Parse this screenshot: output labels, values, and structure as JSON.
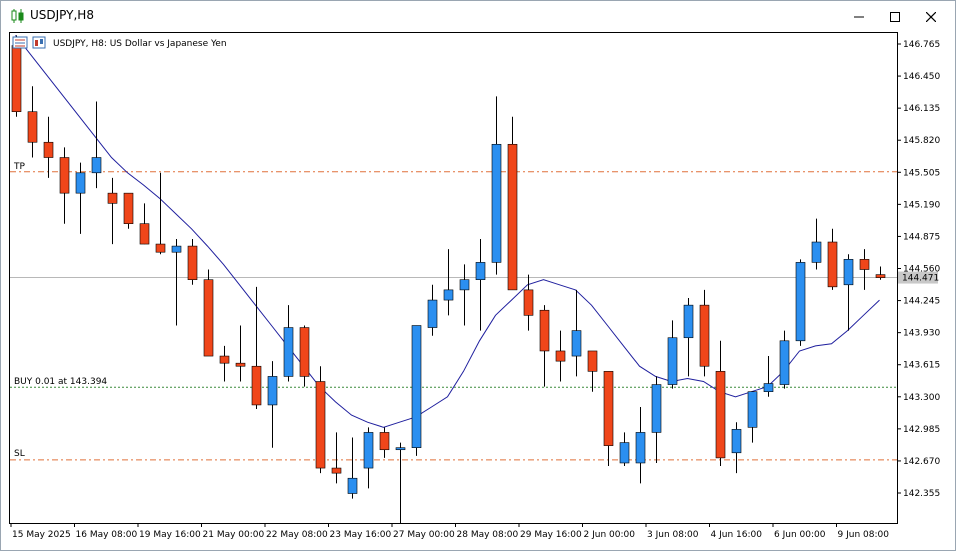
{
  "window": {
    "title": "USDJPY,H8",
    "icon": "candlestick-icon",
    "buttons": [
      "minimize-icon",
      "maximize-icon",
      "close-icon"
    ]
  },
  "chart_header": {
    "symbol_text": "USDJPY, H8:  US Dollar vs Japanese Yen"
  },
  "price_axis": {
    "labels": [
      "146.765",
      "146.450",
      "146.135",
      "145.820",
      "145.505",
      "145.190",
      "144.875",
      "144.560",
      "144.245",
      "143.930",
      "143.615",
      "143.300",
      "142.985",
      "142.670",
      "142.355"
    ],
    "current_price": "144.471"
  },
  "time_axis": {
    "labels": [
      "15 May 2025",
      "16 May 08:00",
      "19 May 16:00",
      "21 May 00:00",
      "22 May 08:00",
      "23 May 16:00",
      "27 May 00:00",
      "28 May 08:00",
      "29 May 16:00",
      "2 Jun 00:00",
      "3 Jun 08:00",
      "4 Jun 16:00",
      "6 Jun 00:00",
      "9 Jun 08:00"
    ]
  },
  "trade_lines": {
    "tp_label": "TP",
    "tp_price": 145.51,
    "buy_label": "BUY 0.01 at 143.394",
    "buy_price": 143.394,
    "sl_label": "SL",
    "sl_price": 142.68
  },
  "colors": {
    "bull": "#2b8ff0",
    "bear": "#f0461a",
    "ma": "#1f1f9e",
    "tp_sl_line": "#e0703a",
    "buy_line": "#3a8a3a",
    "grid_price": "#b8b8b8"
  },
  "chart_data": {
    "type": "candlestick",
    "title": "USDJPY, H8:  US Dollar vs Japanese Yen",
    "ylim": [
      142.2,
      146.85
    ],
    "candles": [
      {
        "o": 146.75,
        "h": 146.85,
        "l": 146.05,
        "c": 146.1
      },
      {
        "o": 146.1,
        "h": 146.35,
        "l": 145.65,
        "c": 145.8
      },
      {
        "o": 145.8,
        "h": 146.05,
        "l": 145.45,
        "c": 145.65
      },
      {
        "o": 145.65,
        "h": 145.75,
        "l": 145.0,
        "c": 145.3
      },
      {
        "o": 145.3,
        "h": 145.6,
        "l": 144.9,
        "c": 145.5
      },
      {
        "o": 145.5,
        "h": 146.2,
        "l": 145.35,
        "c": 145.65
      },
      {
        "o": 145.3,
        "h": 145.45,
        "l": 144.8,
        "c": 145.2
      },
      {
        "o": 145.3,
        "h": 145.3,
        "l": 144.95,
        "c": 145.0
      },
      {
        "o": 145.0,
        "h": 145.2,
        "l": 144.8,
        "c": 144.8
      },
      {
        "o": 144.8,
        "h": 145.5,
        "l": 144.7,
        "c": 144.72
      },
      {
        "o": 144.72,
        "h": 144.85,
        "l": 144.0,
        "c": 144.78
      },
      {
        "o": 144.78,
        "h": 144.85,
        "l": 144.4,
        "c": 144.45
      },
      {
        "o": 144.45,
        "h": 144.55,
        "l": 143.7,
        "c": 143.7
      },
      {
        "o": 143.7,
        "h": 143.8,
        "l": 143.45,
        "c": 143.63
      },
      {
        "o": 143.63,
        "h": 144.0,
        "l": 143.45,
        "c": 143.6
      },
      {
        "o": 143.6,
        "h": 144.38,
        "l": 143.18,
        "c": 143.22
      },
      {
        "o": 143.22,
        "h": 143.65,
        "l": 142.8,
        "c": 143.5
      },
      {
        "o": 143.5,
        "h": 144.2,
        "l": 143.45,
        "c": 143.98
      },
      {
        "o": 143.98,
        "h": 144.0,
        "l": 143.4,
        "c": 143.5
      },
      {
        "o": 143.45,
        "h": 143.6,
        "l": 142.55,
        "c": 142.6
      },
      {
        "o": 142.6,
        "h": 142.95,
        "l": 142.45,
        "c": 142.55
      },
      {
        "o": 142.35,
        "h": 142.9,
        "l": 142.3,
        "c": 142.5
      },
      {
        "o": 142.6,
        "h": 143.0,
        "l": 142.4,
        "c": 142.95
      },
      {
        "o": 142.95,
        "h": 143.0,
        "l": 142.7,
        "c": 142.78
      },
      {
        "o": 142.78,
        "h": 142.85,
        "l": 142.05,
        "c": 142.8
      },
      {
        "o": 142.8,
        "h": 144.0,
        "l": 142.72,
        "c": 144.0
      },
      {
        "o": 143.98,
        "h": 144.4,
        "l": 143.9,
        "c": 144.25
      },
      {
        "o": 144.25,
        "h": 144.75,
        "l": 144.1,
        "c": 144.35
      },
      {
        "o": 144.35,
        "h": 144.6,
        "l": 144.0,
        "c": 144.45
      },
      {
        "o": 144.45,
        "h": 144.85,
        "l": 143.95,
        "c": 144.62
      },
      {
        "o": 144.62,
        "h": 146.25,
        "l": 144.5,
        "c": 145.78
      },
      {
        "o": 145.78,
        "h": 146.05,
        "l": 144.35,
        "c": 144.35
      },
      {
        "o": 144.35,
        "h": 144.5,
        "l": 143.95,
        "c": 144.1
      },
      {
        "o": 144.15,
        "h": 144.2,
        "l": 143.4,
        "c": 143.75
      },
      {
        "o": 143.75,
        "h": 143.95,
        "l": 143.45,
        "c": 143.65
      },
      {
        "o": 143.7,
        "h": 144.35,
        "l": 143.5,
        "c": 143.95
      },
      {
        "o": 143.75,
        "h": 143.75,
        "l": 143.35,
        "c": 143.55
      },
      {
        "o": 143.55,
        "h": 143.55,
        "l": 142.62,
        "c": 142.82
      },
      {
        "o": 142.65,
        "h": 142.95,
        "l": 142.62,
        "c": 142.85
      },
      {
        "o": 142.65,
        "h": 143.2,
        "l": 142.45,
        "c": 142.95
      },
      {
        "o": 142.95,
        "h": 143.5,
        "l": 142.65,
        "c": 143.42
      },
      {
        "o": 143.42,
        "h": 144.05,
        "l": 143.38,
        "c": 143.88
      },
      {
        "o": 143.88,
        "h": 144.27,
        "l": 143.5,
        "c": 144.2
      },
      {
        "o": 144.2,
        "h": 144.35,
        "l": 143.5,
        "c": 143.6
      },
      {
        "o": 143.55,
        "h": 143.85,
        "l": 142.62,
        "c": 142.7
      },
      {
        "o": 142.75,
        "h": 143.05,
        "l": 142.55,
        "c": 142.98
      },
      {
        "o": 143.0,
        "h": 143.35,
        "l": 142.85,
        "c": 143.35
      },
      {
        "o": 143.35,
        "h": 143.7,
        "l": 143.3,
        "c": 143.43
      },
      {
        "o": 143.42,
        "h": 143.95,
        "l": 143.38,
        "c": 143.85
      },
      {
        "o": 143.85,
        "h": 144.65,
        "l": 143.8,
        "c": 144.62
      },
      {
        "o": 144.62,
        "h": 145.05,
        "l": 144.55,
        "c": 144.82
      },
      {
        "o": 144.82,
        "h": 144.95,
        "l": 144.35,
        "c": 144.38
      },
      {
        "o": 144.4,
        "h": 144.7,
        "l": 143.95,
        "c": 144.65
      },
      {
        "o": 144.65,
        "h": 144.75,
        "l": 144.35,
        "c": 144.55
      },
      {
        "o": 144.5,
        "h": 144.58,
        "l": 144.45,
        "c": 144.47
      }
    ],
    "moving_average": [
      146.85,
      146.65,
      146.45,
      146.25,
      146.05,
      145.85,
      145.65,
      145.5,
      145.38,
      145.25,
      145.1,
      144.95,
      144.78,
      144.6,
      144.4,
      144.2,
      144.0,
      143.8,
      143.6,
      143.4,
      143.25,
      143.12,
      143.05,
      143.0,
      143.05,
      143.1,
      143.2,
      143.3,
      143.55,
      143.85,
      144.1,
      144.25,
      144.4,
      144.45,
      144.4,
      144.35,
      144.2,
      144.0,
      143.8,
      143.6,
      143.5,
      143.45,
      143.48,
      143.45,
      143.35,
      143.3,
      143.35,
      143.4,
      143.55,
      143.75,
      143.8,
      143.82,
      143.95,
      144.1,
      144.25
    ]
  }
}
